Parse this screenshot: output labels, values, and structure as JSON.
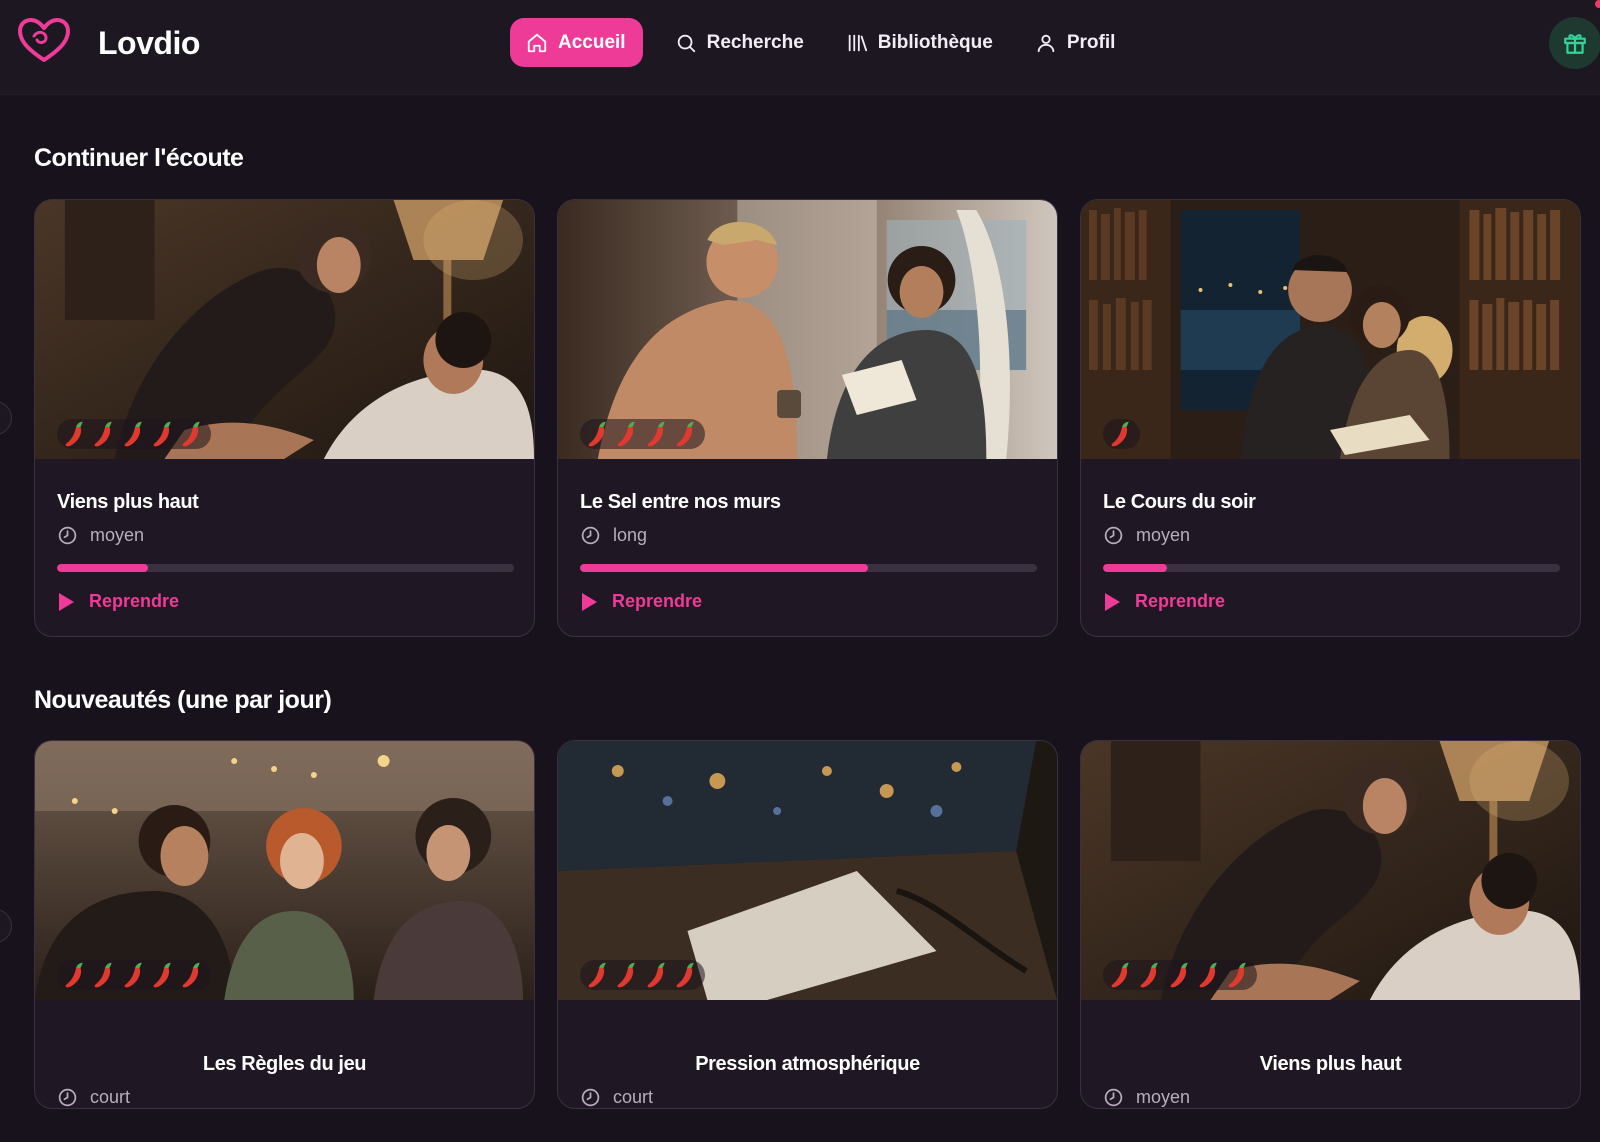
{
  "app": {
    "name": "Lovdio",
    "accent": "#ee3b98"
  },
  "nav": {
    "items": [
      {
        "label": "Accueil",
        "icon": "home-icon",
        "active": true
      },
      {
        "label": "Recherche",
        "icon": "search-icon",
        "active": false
      },
      {
        "label": "Bibliothèque",
        "icon": "library-icon",
        "active": false
      },
      {
        "label": "Profil",
        "icon": "user-icon",
        "active": false
      }
    ],
    "gift_icon": "gift-icon"
  },
  "continue": {
    "title": "Continuer l'écoute",
    "cards": [
      {
        "title": "Viens plus haut",
        "length": "moyen",
        "spice": 5,
        "progress": 0.2,
        "action": "Reprendre"
      },
      {
        "title": "Le Sel entre nos murs",
        "length": "long",
        "spice": 4,
        "progress": 0.63,
        "action": "Reprendre"
      },
      {
        "title": "Le Cours du soir",
        "length": "moyen",
        "spice": 1,
        "progress": 0.14,
        "action": "Reprendre"
      }
    ]
  },
  "new": {
    "title": "Nouveautés (une par jour)",
    "cards": [
      {
        "title": "Les Règles du jeu",
        "length": "court",
        "spice": 5
      },
      {
        "title": "Pression atmosphérique",
        "length": "court",
        "spice": 4
      },
      {
        "title": "Viens plus haut",
        "length": "moyen",
        "spice": 5
      }
    ]
  }
}
